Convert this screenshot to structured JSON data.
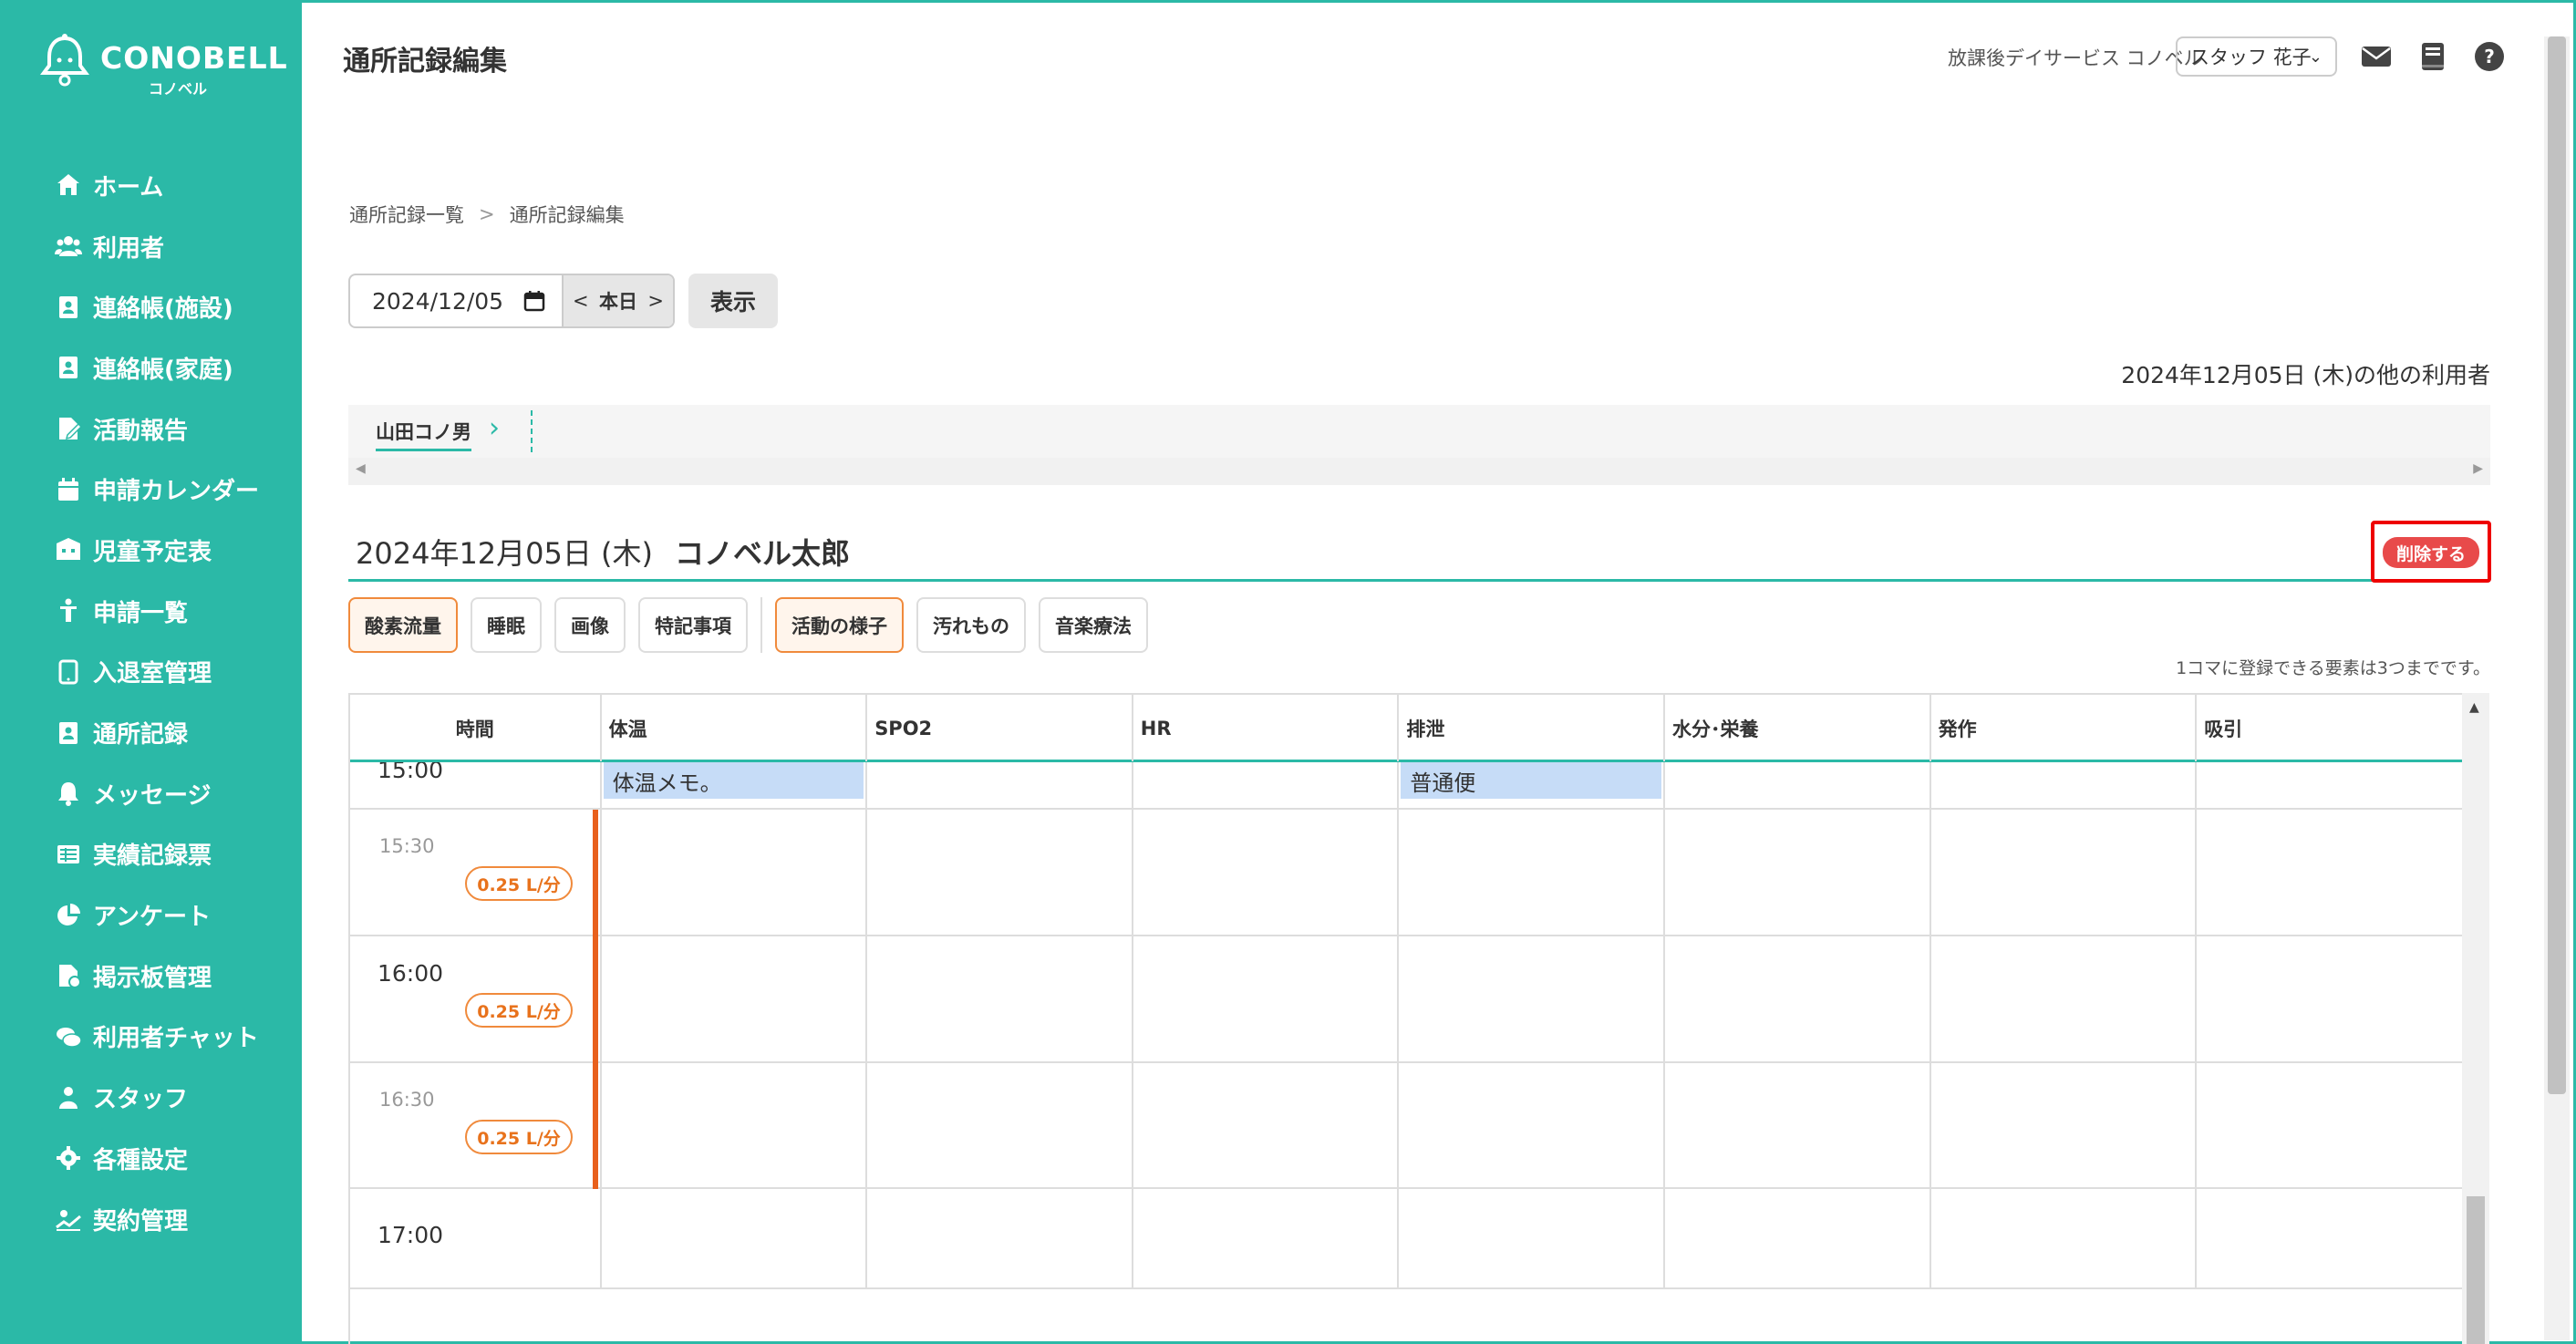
{
  "brand": {
    "name": "CONOBELL",
    "sub": "コノベル"
  },
  "sidebar": {
    "items": [
      {
        "label": "ホーム",
        "icon": "home-icon"
      },
      {
        "label": "利用者",
        "icon": "users-icon"
      },
      {
        "label": "連絡帳(施設)",
        "icon": "contact-book-icon"
      },
      {
        "label": "連絡帳(家庭)",
        "icon": "contact-book-icon"
      },
      {
        "label": "活動報告",
        "icon": "report-icon"
      },
      {
        "label": "申請カレンダー",
        "icon": "calendar-icon"
      },
      {
        "label": "児童予定表",
        "icon": "schedule-icon"
      },
      {
        "label": "申請一覧",
        "icon": "child-icon"
      },
      {
        "label": "入退室管理",
        "icon": "tablet-icon"
      },
      {
        "label": "通所記録",
        "icon": "record-icon"
      },
      {
        "label": "メッセージ",
        "icon": "bell-icon"
      },
      {
        "label": "実績記録票",
        "icon": "table-icon"
      },
      {
        "label": "アンケート",
        "icon": "pie-chart-icon"
      },
      {
        "label": "掲示板管理",
        "icon": "board-icon"
      },
      {
        "label": "利用者チャット",
        "icon": "chat-icon"
      },
      {
        "label": "スタッフ",
        "icon": "staff-icon"
      },
      {
        "label": "各種設定",
        "icon": "gear-icon"
      },
      {
        "label": "契約管理",
        "icon": "contract-icon"
      }
    ]
  },
  "header": {
    "title": "通所記録編集",
    "facility": "放課後デイサービス コノベル",
    "staff": "スタッフ 花子"
  },
  "breadcrumb": {
    "first": "通所記録一覧",
    "sep": ">",
    "second": "通所記録編集"
  },
  "controls": {
    "date": "2024/12/05",
    "prev": "<",
    "today": "本日",
    "next": ">",
    "show": "表示"
  },
  "other_users": {
    "heading": "2024年12月05日 (木)の他の利用者",
    "users": [
      "山田コノ男"
    ]
  },
  "record": {
    "date": "2024年12月05日 (木)",
    "name": "コノベル太郎",
    "delete": "削除する"
  },
  "categories": [
    "酸素流量",
    "睡眠",
    "画像",
    "特記事項",
    "活動の様子",
    "汚れもの",
    "音楽療法"
  ],
  "max_note": "1コマに登録できる要素は3つまでです。",
  "table": {
    "headers": [
      "時間",
      "体温",
      "SPO2",
      "HR",
      "排泄",
      "水分･栄養",
      "発作",
      "吸引"
    ],
    "rows": [
      {
        "time": "15:00",
        "type": "main",
        "o2": "",
        "memos": {
          "体温": "体温メモ。",
          "排泄": "普通便"
        }
      },
      {
        "time": "15:30",
        "type": "sub",
        "o2": "0.25 L/分",
        "memos": {}
      },
      {
        "time": "16:00",
        "type": "main",
        "o2": "0.25 L/分",
        "memos": {}
      },
      {
        "time": "16:30",
        "type": "sub",
        "o2": "0.25 L/分",
        "memos": {}
      },
      {
        "time": "17:00",
        "type": "main",
        "o2": "",
        "memos": {}
      }
    ]
  },
  "colors": {
    "accent": "#2bb9a7",
    "orange": "#f08a3c",
    "danger": "#e84a4a",
    "memo": "#c6dcf7"
  }
}
